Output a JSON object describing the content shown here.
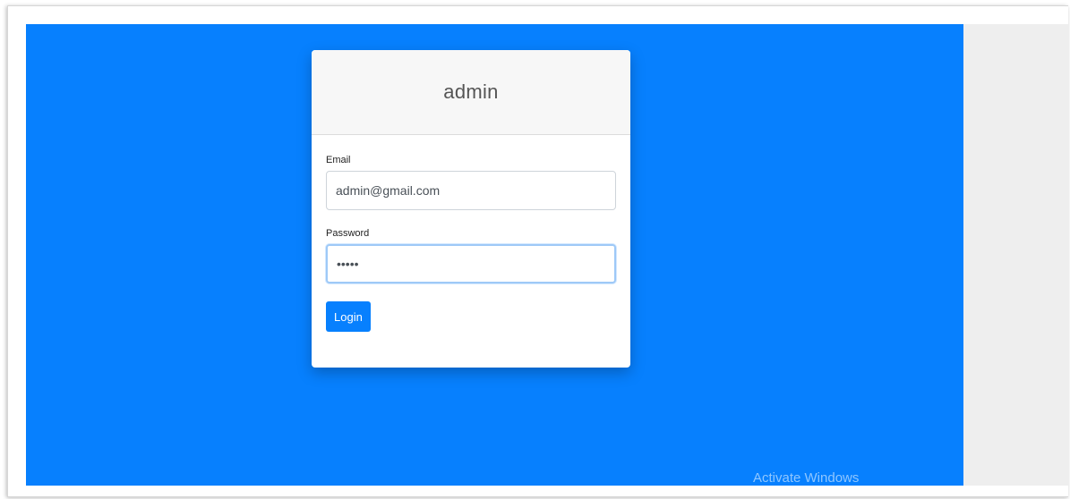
{
  "card": {
    "title": "admin",
    "email_label": "Email",
    "email_value": "admin@gmail.com",
    "password_label": "Password",
    "password_value": "•••••",
    "login_label": "Login"
  },
  "watermark": {
    "text": "Activate Windows"
  },
  "colors": {
    "background_blue": "#0780fe",
    "button_blue": "#0780fe",
    "side_gray": "#eeeeee"
  }
}
